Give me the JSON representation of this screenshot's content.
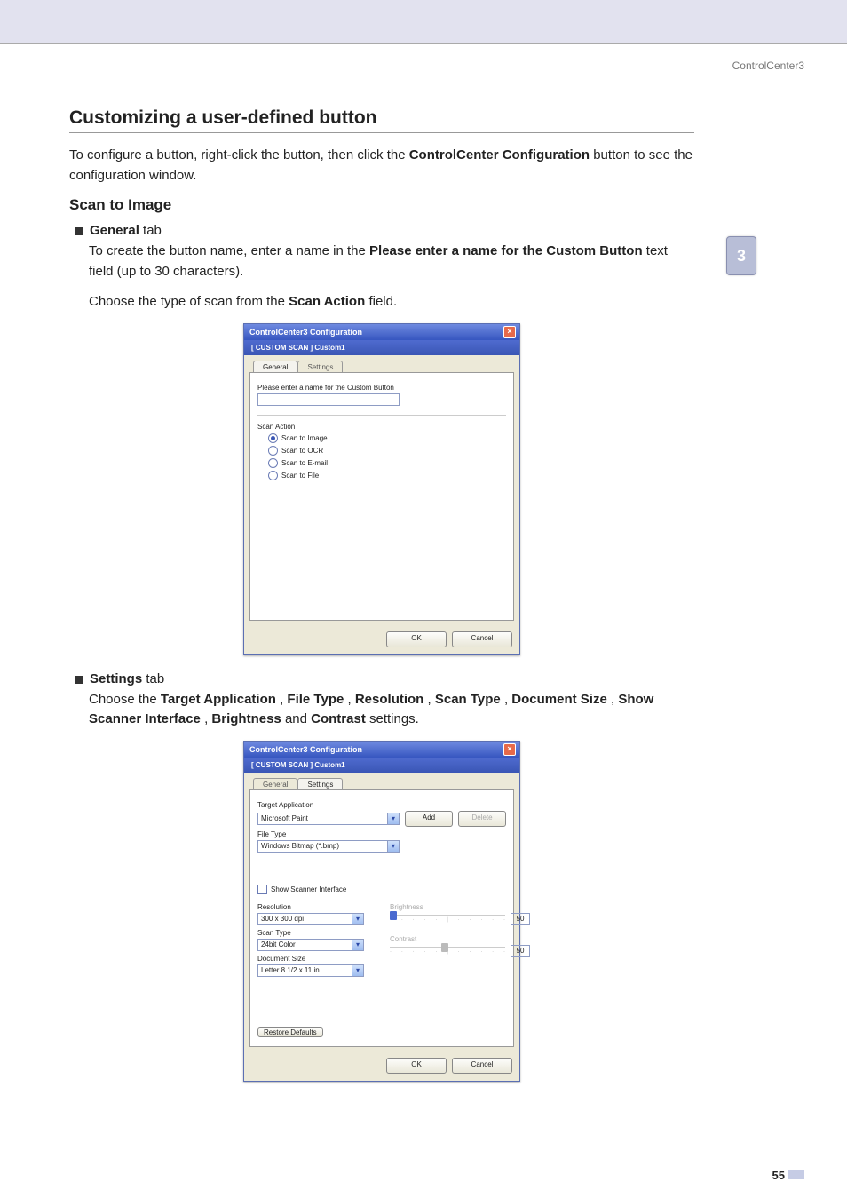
{
  "running_head": "ControlCenter3",
  "side_tab": "3",
  "title": "Customizing a user-defined button",
  "intro_pre": "To configure a button, right-click the button, then click the ",
  "intro_bold1": "ControlCenter Configuration",
  "intro_post": " button to see the configuration window.",
  "subtitle": "Scan to Image",
  "bullet_general": {
    "bold": "General",
    "rest": " tab"
  },
  "general_p1_pre": "To create the button name, enter a name in the ",
  "general_p1_bold": "Please enter a name for the Custom Button",
  "general_p1_post": " text field (up to 30 characters).",
  "general_p2_pre": "Choose the type of scan from the ",
  "general_p2_bold": "Scan Action",
  "general_p2_post": " field.",
  "bullet_settings": {
    "bold": "Settings",
    "rest": " tab"
  },
  "settings_p_parts": {
    "p0": "Choose the ",
    "b0": "Target Application",
    "p1": ", ",
    "b1": "File Type",
    "p2": ", ",
    "b2": "Resolution",
    "p3": ", ",
    "b3": "Scan Type",
    "p4": ", ",
    "b4": "Document Size",
    "p5": ", ",
    "b5": "Show Scanner Interface",
    "p6": ", ",
    "b6": "Brightness",
    "p7": " and ",
    "b7": "Contrast",
    "p8": " settings."
  },
  "dlg1": {
    "title": "ControlCenter3 Configuration",
    "breadcrumb": "[ CUSTOM SCAN ]  Custom1",
    "tabs": {
      "general": "General",
      "settings": "Settings"
    },
    "name_label": "Please enter a name for the Custom Button",
    "name_value": "",
    "scan_action_label": "Scan Action",
    "radios": {
      "image": "Scan to Image",
      "ocr": "Scan to OCR",
      "email": "Scan to E-mail",
      "file": "Scan to File"
    },
    "ok": "OK",
    "cancel": "Cancel"
  },
  "dlg2": {
    "title": "ControlCenter3 Configuration",
    "breadcrumb": "[ CUSTOM SCAN ]  Custom1",
    "tabs": {
      "general": "General",
      "settings": "Settings"
    },
    "target_app_label": "Target Application",
    "target_app_value": "Microsoft Paint",
    "add": "Add",
    "delete": "Delete",
    "file_type_label": "File Type",
    "file_type_value": "Windows Bitmap (*.bmp)",
    "show_scanner_label": "Show Scanner Interface",
    "resolution_label": "Resolution",
    "resolution_value": "300 x 300 dpi",
    "scan_type_label": "Scan Type",
    "scan_type_value": "24bit Color",
    "doc_size_label": "Document Size",
    "doc_size_value": "Letter 8 1/2 x 11 in",
    "brightness_label": "Brightness",
    "contrast_label": "Contrast",
    "brightness_value": "50",
    "contrast_value": "50",
    "restore": "Restore Defaults",
    "ok": "OK",
    "cancel": "Cancel"
  },
  "page_number": "55"
}
